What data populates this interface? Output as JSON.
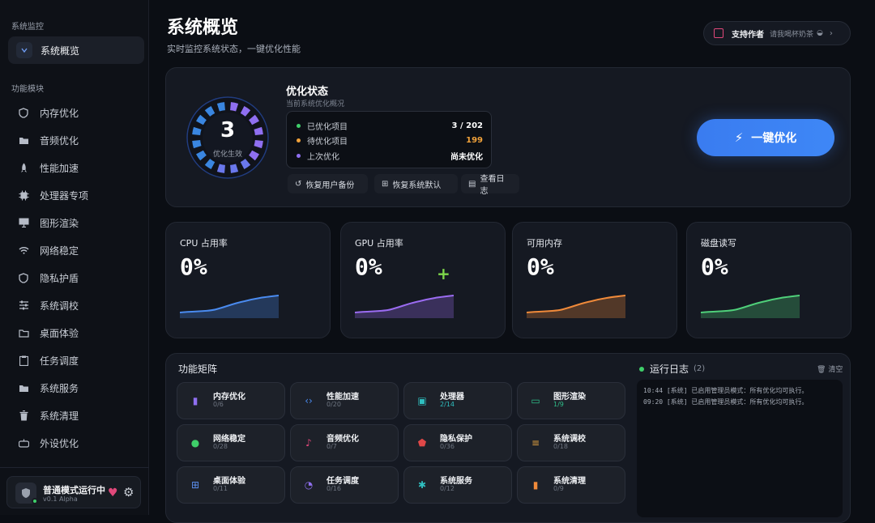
{
  "sidebar": {
    "section_monitor": "系统监控",
    "active_item": "系统概览",
    "section_modules": "功能模块",
    "items": [
      "内存优化",
      "音频优化",
      "性能加速",
      "处理器专项",
      "图形渲染",
      "网络稳定",
      "隐私护盾",
      "系统调校",
      "桌面体验",
      "任务调度",
      "系统服务",
      "系统清理",
      "外设优化"
    ],
    "status_title": "普通模式运行中",
    "status_sub": "v0.1 Alpha"
  },
  "header": {
    "title": "系统概览",
    "subtitle": "实时监控系统状态，一键优化性能",
    "support_label": "支持作者",
    "support_sub": "请我喝杯奶茶"
  },
  "optimization": {
    "ring_value": "3",
    "ring_label": "优化生效",
    "title": "优化状态",
    "subtitle": "当前系统优化概况",
    "rows": [
      {
        "label": "已优化项目",
        "value": "3 / 202",
        "dot": "#3fcf6a",
        "color": "#ffffff"
      },
      {
        "label": "待优化项目",
        "value": "199",
        "dot": "#f0a13a",
        "color": "#f0a13a"
      },
      {
        "label": "上次优化",
        "value": "尚未优化",
        "dot": "#8f6ff0",
        "color": "#ffffff"
      }
    ],
    "actions": [
      "恢复用户备份",
      "恢复系统默认",
      "查看日志"
    ],
    "button_label": "一键优化"
  },
  "metrics": [
    {
      "label": "CPU 占用率",
      "value": "0%",
      "color": "#4a8bf0"
    },
    {
      "label": "GPU 占用率",
      "value": "0%",
      "color": "#9b6cf2"
    },
    {
      "label": "可用内存",
      "value": "0%",
      "color": "#f08a3a"
    },
    {
      "label": "磁盘读写",
      "value": "0%",
      "color": "#4fd07a"
    }
  ],
  "matrix": {
    "title": "功能矩阵",
    "tiles": [
      {
        "name": "内存优化",
        "count": "0/6",
        "icon": "bar-chart-icon",
        "color": "#8f6ff0"
      },
      {
        "name": "性能加速",
        "count": "0/20",
        "icon": "code-icon",
        "color": "#4a8bf0"
      },
      {
        "name": "处理器",
        "count": "2/14",
        "icon": "chip-icon",
        "color": "#2fbfc0"
      },
      {
        "name": "图形渲染",
        "count": "1/9",
        "icon": "monitor-icon",
        "color": "#2fbf8a"
      },
      {
        "name": "网络稳定",
        "count": "0/28",
        "icon": "globe-icon",
        "color": "#3fcf6a"
      },
      {
        "name": "音频优化",
        "count": "0/7",
        "icon": "music-note-icon",
        "color": "#e0487a"
      },
      {
        "name": "隐私保护",
        "count": "0/36",
        "icon": "shield-icon",
        "color": "#e04848"
      },
      {
        "name": "系统调校",
        "count": "0/18",
        "icon": "sliders-icon",
        "color": "#e0a040"
      },
      {
        "name": "桌面体验",
        "count": "0/11",
        "icon": "grid-icon",
        "color": "#5b8ff0"
      },
      {
        "name": "任务调度",
        "count": "0/16",
        "icon": "clock-icon",
        "color": "#8f6ff0"
      },
      {
        "name": "系统服务",
        "count": "0/12",
        "icon": "gear-icon",
        "color": "#2fbfc0"
      },
      {
        "name": "系统清理",
        "count": "0/9",
        "icon": "trash-icon",
        "color": "#f08a3a"
      }
    ]
  },
  "log": {
    "title": "运行日志",
    "count": "(2)",
    "clear_label": "清空",
    "lines": [
      "10:44 [系统] 已启用管理员模式：所有优化均可执行。",
      "09:20 [系统] 已启用管理员模式：所有优化均可执行。"
    ]
  }
}
